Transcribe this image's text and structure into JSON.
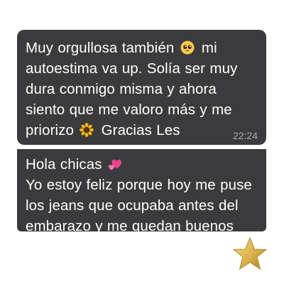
{
  "messages": [
    {
      "lines": [
        {
          "before": "Muy orgullosa también ",
          "emoji": "pleading-face-emoji",
          "after": " mi"
        },
        {
          "text": "autoestima va up. Solía ser muy"
        },
        {
          "text": "dura conmigo misma y ahora"
        },
        {
          "text": "siento que me valoro más y me"
        },
        {
          "before": "priorizo ",
          "emoji": "sunflower-emoji",
          "after": " Gracias Les"
        }
      ],
      "time": "22:24",
      "background": "#3b3b3d"
    },
    {
      "lines": [
        {
          "before": "Hola chicas ",
          "emoji": "two-hearts-emoji",
          "after": ""
        },
        {
          "text": "Yo estoy feliz porque hoy me puse"
        },
        {
          "text": "los jeans que ocupaba antes del"
        },
        {
          "text": "embarazo y me quedan buenos"
        }
      ],
      "background": "#3b3b3d"
    }
  ],
  "decoration": {
    "icon": "star-icon",
    "color": "#d8b24a"
  }
}
